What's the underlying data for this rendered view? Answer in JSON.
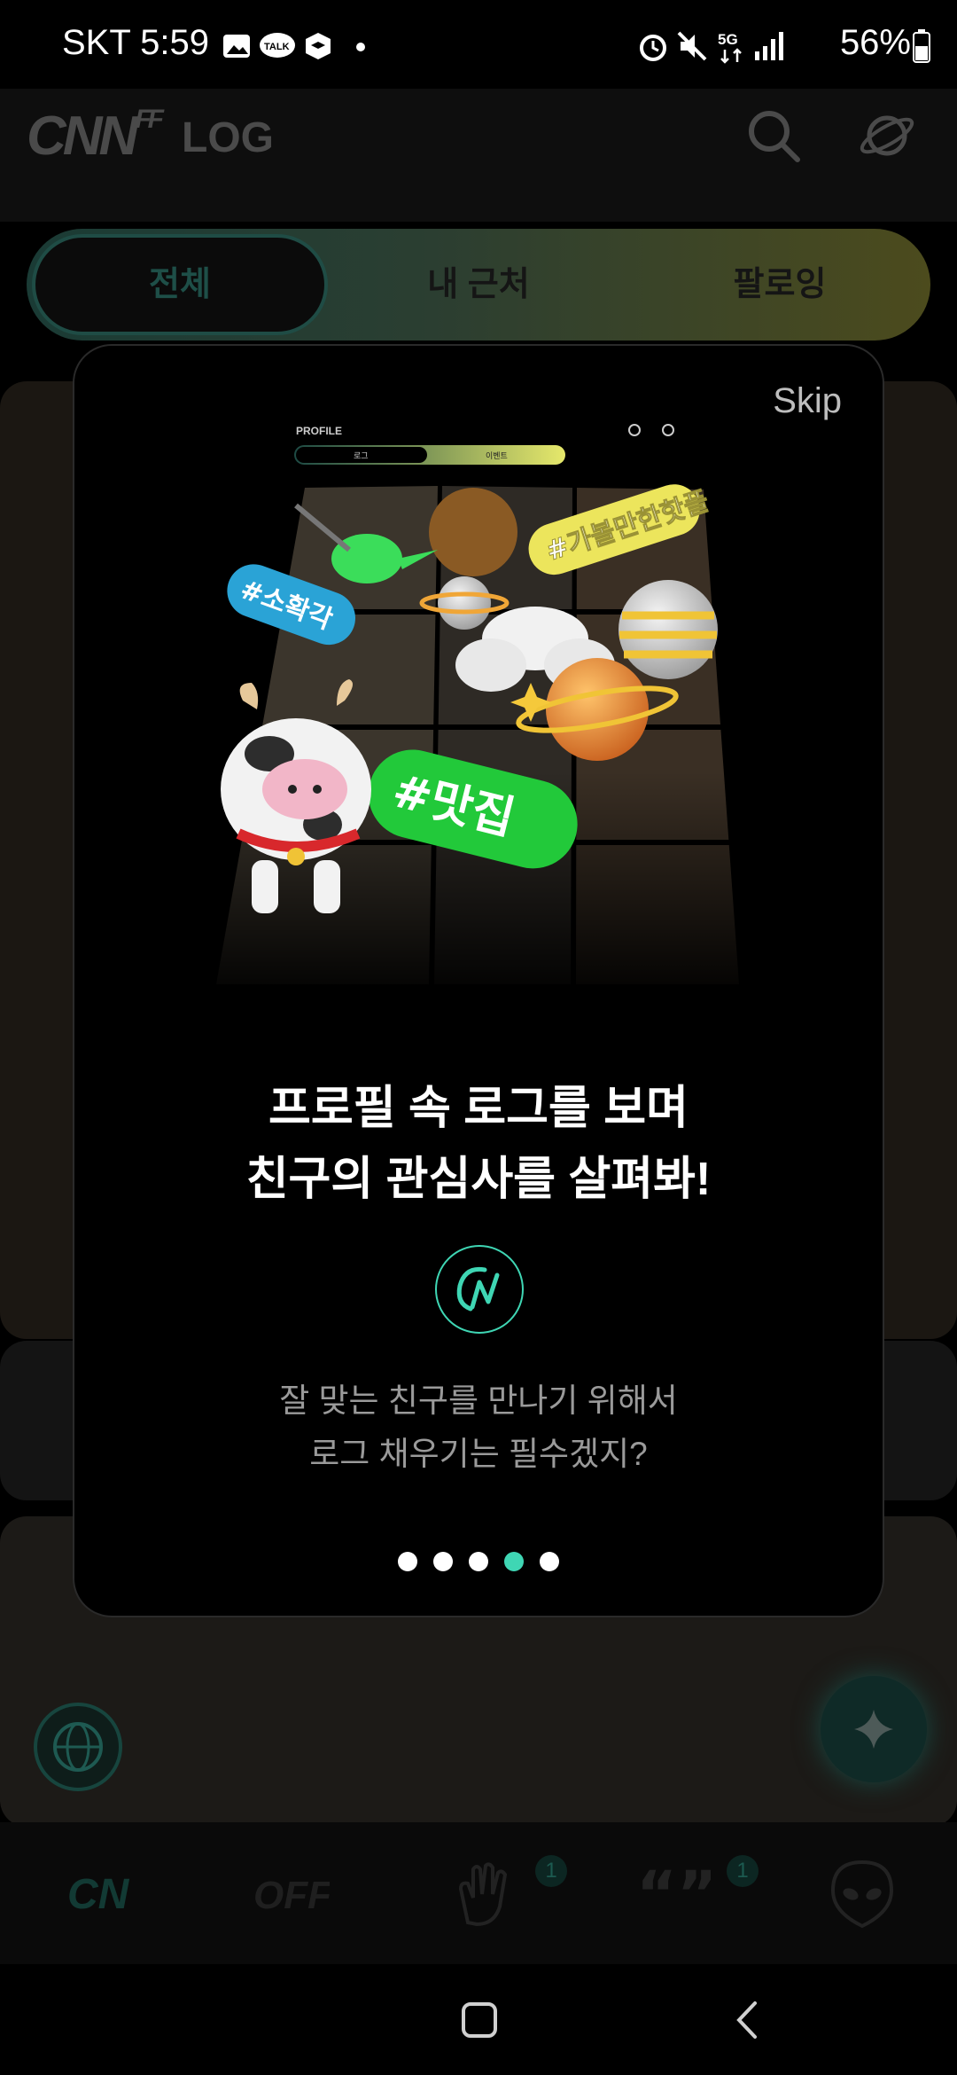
{
  "status_bar": {
    "carrier_time": "SKT 5:59",
    "battery": "56%",
    "icons": [
      "gallery-icon",
      "talk-icon",
      "box-icon",
      "dot-icon",
      "alarm-icon",
      "mute-icon",
      "5g-icon",
      "signal-icon",
      "battery-icon"
    ]
  },
  "header": {
    "logo_main": "CNN",
    "logo_sup": "FF",
    "title": "LOG",
    "icons": [
      "search-icon",
      "planet-icon"
    ]
  },
  "tabs": [
    {
      "label": "전체",
      "active": true
    },
    {
      "label": "내 근처",
      "active": false
    },
    {
      "label": "팔로잉",
      "active": false
    }
  ],
  "bottom_nav": {
    "items": [
      "cn-icon",
      "off-icon",
      "hand-icon",
      "quote-icon",
      "alien-icon"
    ],
    "badges": {
      "hand": "1",
      "quote": "1"
    }
  },
  "modal": {
    "skip_label": "Skip",
    "illustration": {
      "profile_label": "PROFILE",
      "tab_left": "로그",
      "tab_right": "이벤트",
      "tags": [
        "#소확각",
        "#가볼만한핫플",
        "#맛집"
      ]
    },
    "headline_line1": "프로필 속 로그를 보며",
    "headline_line2": "친구의 관심사를 살펴봐!",
    "sub_line1": "잘 맞는 친구를 만나기 위해서",
    "sub_line2": "로그 채우기는 필수겠지?",
    "pagination": {
      "total": 5,
      "active_index": 3
    },
    "accent_color": "#3fd6b4"
  }
}
